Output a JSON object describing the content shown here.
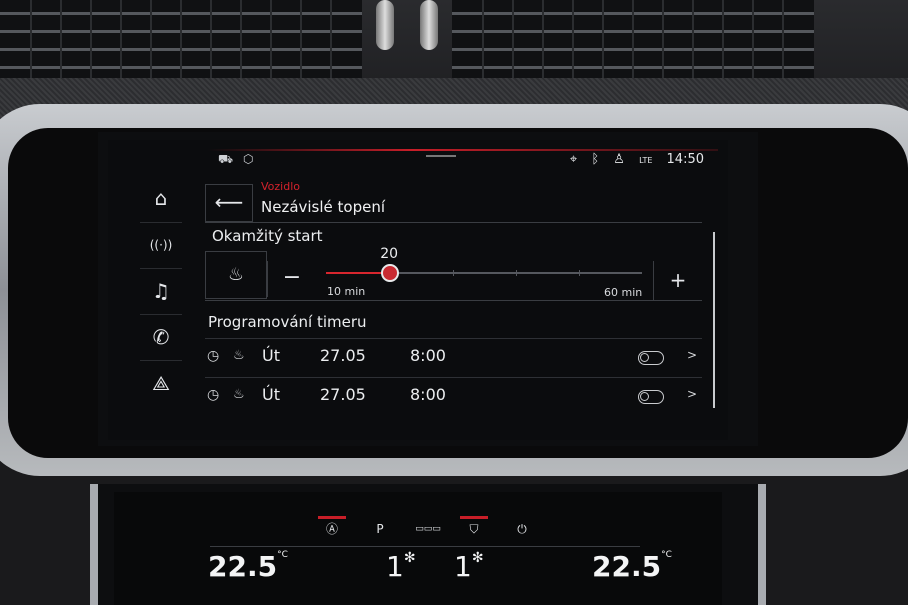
{
  "status_bar": {
    "left_icons": [
      "car-icon",
      "cube-icon"
    ],
    "right_icons": [
      "location-icon",
      "bluetooth-icon",
      "user-icon",
      "lte-signal-icon"
    ],
    "lte_label": "LTE",
    "time": "14:50"
  },
  "sidenav": {
    "items": [
      {
        "icon": "home-icon",
        "glyph": "⌂"
      },
      {
        "icon": "car-remote-icon",
        "glyph": "((·))"
      },
      {
        "icon": "music-icon",
        "glyph": "♫"
      },
      {
        "icon": "phone-icon",
        "glyph": "✆"
      },
      {
        "icon": "navigation-icon",
        "glyph": "⟁"
      }
    ]
  },
  "header": {
    "back_glyph": "⟵",
    "breadcrumb": "Vozidlo",
    "title": "Nezávislé topení"
  },
  "instant_start": {
    "heading": "Okamžitý start",
    "heater_glyph": "♨",
    "minus": "−",
    "plus": "+",
    "value": 20,
    "value_label": "20",
    "min": 10,
    "max": 60,
    "min_label": "10 min",
    "max_label": "60 min",
    "accent": "#d8262e"
  },
  "timer": {
    "heading": "Programování timeru",
    "rows": [
      {
        "clock_glyph": "◷",
        "heat_glyph": "♨",
        "day": "Út",
        "date": "27.05",
        "time": "8:00",
        "enabled": false,
        "chevron": ">"
      },
      {
        "clock_glyph": "◷",
        "heat_glyph": "♨",
        "day": "Út",
        "date": "27.05",
        "time": "8:00",
        "enabled": false,
        "chevron": ">"
      }
    ]
  },
  "climate": {
    "buttons": [
      "Ⓐ",
      "P",
      "▭▭▭",
      "⛉",
      "⏻"
    ],
    "button_icons": [
      "auto-off-icon",
      "park-assist-icon",
      "rear-defrost-icon",
      "windshield-heat-icon",
      "power-icon"
    ],
    "left_temp": "22.5",
    "right_temp": "22.5",
    "temp_unit": "°C",
    "left_fan": "1",
    "right_fan": "1",
    "fan_glyph": "✻"
  }
}
